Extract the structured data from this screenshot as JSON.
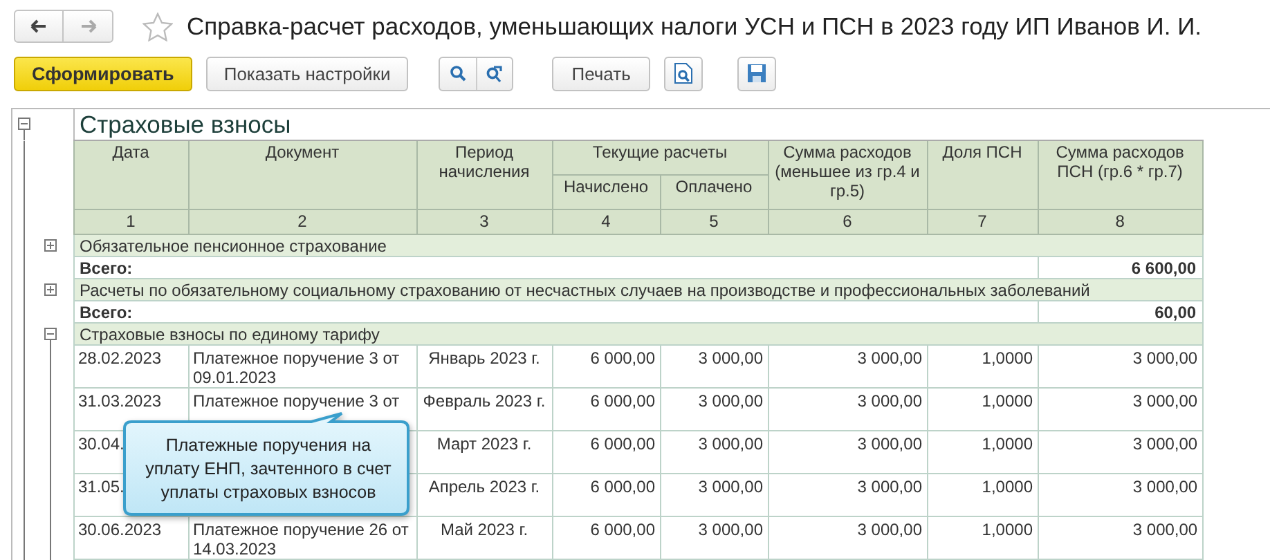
{
  "window": {
    "title": "Справка-расчет расходов, уменьшающих налоги УСН и ПСН в 2023 году ИП Иванов И. И."
  },
  "toolbar": {
    "generate": "Сформировать",
    "settings": "Показать настройки",
    "print": "Печать"
  },
  "report": {
    "title": "Страховые взносы",
    "expanded": true,
    "columns": [
      {
        "label": "Дата"
      },
      {
        "label": "Документ"
      },
      {
        "label": "Период начисления"
      },
      {
        "label": "Текущие расчеты",
        "children": [
          {
            "label": "Начислено"
          },
          {
            "label": "Оплачено"
          }
        ]
      },
      {
        "label": "Сумма расходов (меньшее из гр.4 и гр.5)"
      },
      {
        "label": "Доля ПСН"
      },
      {
        "label": "Сумма расходов ПСН (гр.6 * гр.7)"
      }
    ],
    "column_numbers": [
      "1",
      "2",
      "3",
      "4",
      "5",
      "6",
      "7",
      "8"
    ],
    "sections": [
      {
        "name": "Обязательное пенсионное страхование",
        "expanded": false,
        "total_label": "Всего:",
        "total": "6 600,00"
      },
      {
        "name": "Расчеты по обязательному социальному страхованию от несчастных случаев на производстве и профессиональных заболеваний",
        "expanded": false,
        "total_label": "Всего:",
        "total": "60,00"
      },
      {
        "name": "Страховые взносы по единому тарифу",
        "expanded": true,
        "rows": [
          {
            "date": "28.02.2023",
            "document": "Платежное поручение 3 от 09.01.2023",
            "period": "Январь 2023 г.",
            "accrued": "6 000,00",
            "paid": "3 000,00",
            "expense": "3 000,00",
            "share": "1,0000",
            "psn_expense": "3 000,00"
          },
          {
            "date": "31.03.2023",
            "document": "Платежное поручение 3 от",
            "period": "Февраль 2023 г.",
            "accrued": "6 000,00",
            "paid": "3 000,00",
            "expense": "3 000,00",
            "share": "1,0000",
            "psn_expense": "3 000,00"
          },
          {
            "date": "30.04.",
            "period": "Март 2023 г.",
            "accrued": "6 000,00",
            "paid": "3 000,00",
            "expense": "3 000,00",
            "share": "1,0000",
            "psn_expense": "3 000,00"
          },
          {
            "date": "31.05.",
            "period": "Апрель 2023 г.",
            "accrued": "6 000,00",
            "paid": "3 000,00",
            "expense": "3 000,00",
            "share": "1,0000",
            "psn_expense": "3 000,00"
          },
          {
            "date": "30.06.2023",
            "document": "Платежное поручение 26 от 14.03.2023",
            "period": "Май 2023 г.",
            "accrued": "6 000,00",
            "paid": "3 000,00",
            "expense": "3 000,00",
            "share": "1,0000",
            "psn_expense": "3 000,00"
          }
        ]
      }
    ]
  },
  "callout": {
    "text": "Платежные поручения на уплату ЕНП, зачтенного в счет уплаты страховых взносов"
  }
}
